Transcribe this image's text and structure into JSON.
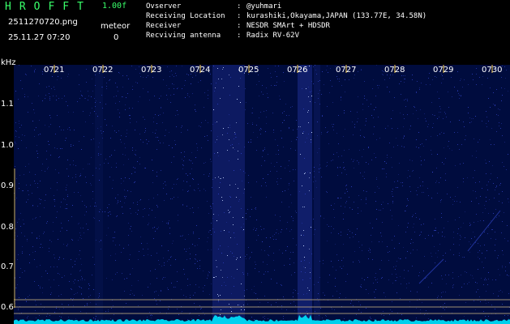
{
  "header": {
    "app_name": "HROFFT",
    "version": "1.00f",
    "file_name": "2511270720.png",
    "mode": "meteor",
    "datetime": "25.11.27 07:20",
    "count": "0"
  },
  "info": [
    {
      "label": "Ovserver",
      "value": "@yuhmari"
    },
    {
      "label": "Receiving Location",
      "value": "kurashiki,Okayama,JAPAN (133.77E, 34.58N)"
    },
    {
      "label": "Receiver",
      "value": "NESDR SMArt + HDSDR"
    },
    {
      "label": "Recviving antenna",
      "value": "Radix RV-62V"
    }
  ],
  "spectrogram": {
    "frequency_unit": "kHz",
    "y_ticks": [
      "1.1",
      "1.0",
      "0.9",
      "0.8",
      "0.7",
      "0.6"
    ],
    "time_ticks": [
      "0721",
      "0722",
      "0723",
      "0724",
      "0725",
      "0726",
      "0727",
      "0728",
      "0729",
      "0730"
    ],
    "colors": {
      "background": "#000c3e",
      "noise": "#3a4fe0",
      "signal": "#c8d8ff",
      "marker_lines": "#c8b080",
      "trace": "#00e5ff",
      "tick": "#ffd24a"
    }
  }
}
